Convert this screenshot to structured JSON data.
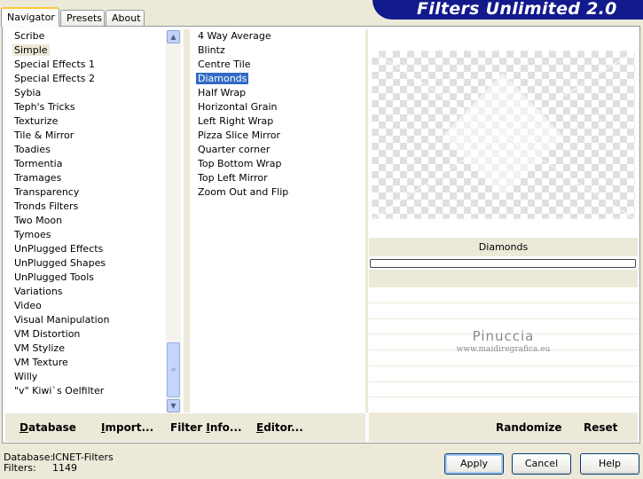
{
  "tabs": [
    {
      "label": "Navigator"
    },
    {
      "label": "Presets"
    },
    {
      "label": "About"
    }
  ],
  "title": "Filters Unlimited 2.0",
  "categories": [
    "Scribe",
    "Simple",
    "Special Effects 1",
    "Special Effects 2",
    "Sybia",
    "Teph's Tricks",
    "Texturize",
    "Tile & Mirror",
    "Toadies",
    "Tormentia",
    "Tramages",
    "Transparency",
    "Tronds Filters",
    "Two Moon",
    "Tymoes",
    "UnPlugged Effects",
    "UnPlugged Shapes",
    "UnPlugged Tools",
    "Variations",
    "Video",
    "Visual Manipulation",
    "VM Distortion",
    "VM Stylize",
    "VM Texture",
    "Willy",
    "\"v\" Kiwi`s Oelfilter"
  ],
  "selected_category": "Simple",
  "filters": [
    "4 Way Average",
    "Blintz",
    "Centre Tile",
    "Diamonds",
    "Half Wrap",
    "Horizontal Grain",
    "Left Right Wrap",
    "Pizza Slice Mirror",
    "Quarter corner",
    "Top Bottom Wrap",
    "Top Left Mirror",
    "Zoom Out and Flip"
  ],
  "selected_filter": "Diamonds",
  "preview": {
    "filter_name": "Diamonds",
    "watermark_name": "Pinuccia",
    "watermark_url": "www.maidiregrafica.eu",
    "slider_rows": 8
  },
  "bottom_buttons": {
    "database": {
      "ul": "D",
      "rest": "atabase"
    },
    "import": {
      "ul": "I",
      "rest": "mport..."
    },
    "filter_info": {
      "pre": "Filter ",
      "ul": "I",
      "rest": "nfo..."
    },
    "editor": {
      "ul": "E",
      "rest": "ditor..."
    },
    "randomize": "Randomize",
    "reset": "Reset"
  },
  "footer": {
    "database_label": "Database:",
    "database_value": "ICNET-Filters",
    "filters_label": "Filters:",
    "filters_value": "1149"
  },
  "dialog_buttons": {
    "apply": "Apply",
    "cancel": "Cancel",
    "help": "Help"
  },
  "colors": {
    "selection": "#316ac5",
    "title_banner": "#121a8c",
    "dialog_bg": "#ece9d8"
  }
}
